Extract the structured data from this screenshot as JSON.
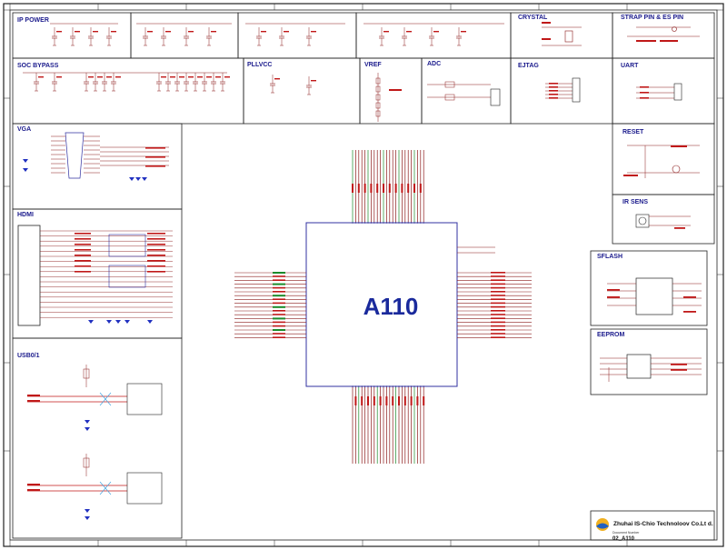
{
  "colors": {
    "border": "#222222",
    "wire": "#8b1a1a",
    "net": "#c01818",
    "net_alt": "#1a8a2a",
    "ic_outline": "#3030a0",
    "title_blue": "#1a1a8c",
    "diode": "#2030c0",
    "logo_yellow": "#f0b020",
    "logo_blue": "#2060c0"
  },
  "panels": {
    "ip_power": "IP POWER",
    "crystal": "CRYSTAL",
    "strap": "STRAP PIN & ES PIN",
    "soc_bypass": "SOC BYPASS",
    "pllvcc": "PLLVCC",
    "vref": "VREF",
    "adc": "ADC",
    "ejtag": "EJTAG",
    "uart": "UART",
    "vga": "VGA",
    "reset": "RESET",
    "hdmi": "HDMI",
    "irsens": "IR SENS",
    "sflash": "SFLASH",
    "usb": "USB0/1",
    "eeprom": "EEPROM"
  },
  "chip": {
    "label": "A110"
  },
  "title_block": {
    "company": "Zhuhai IS-Chio Technoloov Co.Lt d.",
    "doc_number": "02_A110",
    "doc_caption": "Document Number"
  }
}
